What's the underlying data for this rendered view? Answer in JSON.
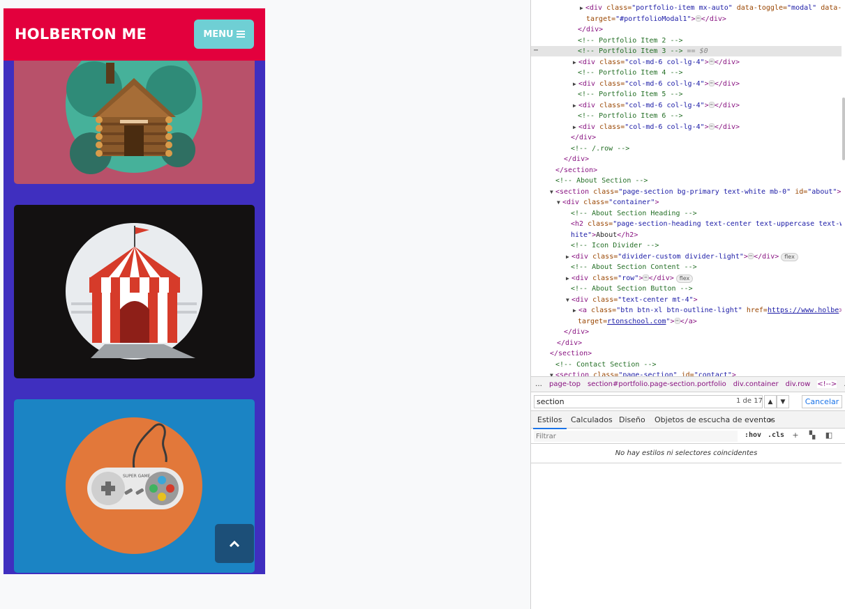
{
  "site": {
    "brand": "HOLBERTON ME",
    "menu_label": "MENU",
    "portfolio_items": [
      {
        "name": "cabin"
      },
      {
        "name": "circus-tent"
      },
      {
        "name": "game-controller"
      }
    ],
    "controller_brand": "SUPER GAME",
    "scroll_top_icon": "chevron-up-icon",
    "colors": {
      "navbar": "#e3003d",
      "menu_button": "#6fcfd4",
      "page_bg": "#3f2fbf",
      "card_cabin": "#b8516a",
      "card_circus": "#131111",
      "card_game": "#1b84c4",
      "scroll_top": "#1c4f78"
    }
  },
  "devtools": {
    "lines": [
      {
        "t1": "<div",
        "a1": " class=",
        "v1": "\"portfolio-item mx-auto\"",
        "a2": " data-toggle=",
        "v2": "\"modal\"",
        "a3": " data-",
        "ell": "…",
        "t2": "</div>"
      },
      {
        "a1": "target=",
        "v1": "\"#portfolioModal1\"",
        "t2": "</div>"
      },
      {
        "t1": "</div>"
      },
      {
        "c": "<!-- Portfolio Item 2 -->"
      },
      {
        "c": "<!-- Portfolio Item 3 -->",
        "d": "== $0"
      },
      {
        "t1": "<div",
        "a1": " class=",
        "v1": "\"col-md-6 col-lg-4\"",
        "t2": "</div>"
      },
      {
        "c": "<!-- Portfolio Item 4 -->"
      },
      {
        "t1": "<div",
        "a1": " class=",
        "v1": "\"col-md-6 col-lg-4\"",
        "t2": "</div>"
      },
      {
        "c": "<!-- Portfolio Item 5 -->"
      },
      {
        "t1": "<div",
        "a1": " class=",
        "v1": "\"col-md-6 col-lg-4\"",
        "t2": "</div>"
      },
      {
        "c": "<!-- Portfolio Item 6 -->"
      },
      {
        "t1": "<div",
        "a1": " class=",
        "v1": "\"col-md-6 col-lg-4\"",
        "t2": "</div>"
      },
      {
        "t1": "</div>"
      },
      {
        "c": "<!-- /.row -->"
      },
      {
        "t1": "</div>"
      },
      {
        "t1": "</section>"
      },
      {
        "c": "<!-- About Section -->"
      },
      {
        "t1": "<section",
        "a1": " class=",
        "v1": "\"page-section bg-primary text-white mb-0\"",
        "a2": " id=",
        "v2": "\"about\""
      },
      {
        "t1": "<div",
        "a1": " class=",
        "v1": "\"container\""
      },
      {
        "c": "<!-- About Section Heading -->"
      },
      {
        "t1": "<h2",
        "a1": " class=",
        "v1": "\"page-section-heading text-center text-uppercase text-w"
      },
      {
        "v1": "hite\"",
        "x": "About",
        "t2": "</h2>"
      },
      {
        "c": "<!-- Icon Divider -->"
      },
      {
        "t1": "<div",
        "a1": " class=",
        "v1": "\"divider-custom divider-light\"",
        "t2": "</div>",
        "b": "flex"
      },
      {
        "c": "<!-- About Section Content -->"
      },
      {
        "t1": "<div",
        "a1": " class=",
        "v1": "\"row\"",
        "t2": "</div>",
        "b": "flex"
      },
      {
        "c": "<!-- About Section Button -->"
      },
      {
        "t1": "<div",
        "a1": " class=",
        "v1": "\"text-center mt-4\""
      },
      {
        "t1": "<a",
        "a1": " class=",
        "v1": "\"btn btn-xl btn-outline-light\"",
        "a2": " href=",
        "l": "https://www.holbe"
      },
      {
        "l": "rtonschool.com",
        "a2": " target=",
        "v2": "\"_blank\"",
        "t2": "</a>"
      },
      {
        "t1": "</div>"
      },
      {
        "t1": "</div>"
      },
      {
        "t1": "</section>"
      },
      {
        "c": "<!-- Contact Section -->"
      },
      {
        "t1": "<section",
        "a1": " class=",
        "v1": "\"page-section\"",
        "a2": " id=",
        "v2": "\"contact\""
      }
    ],
    "breadcrumbs": [
      "…",
      "page-top",
      "section#portfolio.page-section.portfolio",
      "div.container",
      "div.row",
      "<!-->",
      "…"
    ],
    "search": {
      "value": "section",
      "count": "1 de 17",
      "cancel": "Cancelar"
    },
    "tabs": [
      "Estilos",
      "Calculados",
      "Diseño",
      "Objetos de escucha de eventos",
      "»"
    ],
    "filter": {
      "placeholder": "Filtrar",
      "hov": ":hov",
      "cls": ".cls"
    },
    "empty_message": "No hay estilos ni selectores coincidentes"
  }
}
